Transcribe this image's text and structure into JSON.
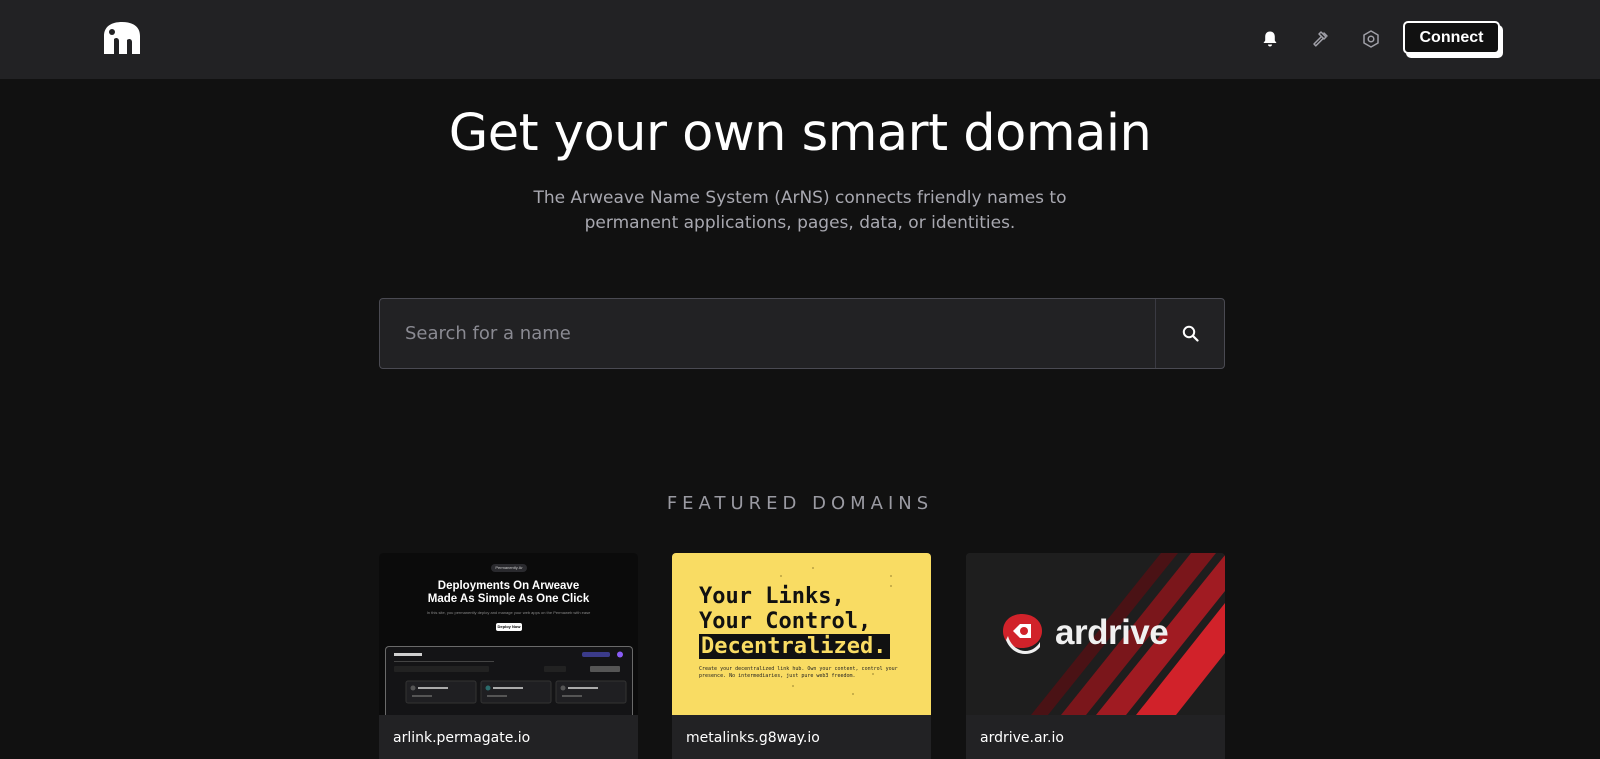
{
  "header": {
    "logo_icon": "elephant-logo-icon",
    "icons": [
      "bell-icon",
      "hammer-icon",
      "settings-hexagon-icon"
    ],
    "connect_label": "Connect"
  },
  "hero": {
    "title": "Get your own smart domain",
    "subtitle_line1": "The Arweave Name System (ArNS) connects friendly names to",
    "subtitle_line2": "permanent applications, pages, data, or identities."
  },
  "search": {
    "placeholder": "Search for a name",
    "button_icon": "search-icon"
  },
  "featured": {
    "heading": "FEATURED DOMAINS",
    "cards": [
      {
        "label": "arlink.permagate.io",
        "thumb": {
          "pill": "Permanently Ar",
          "title_line1": "Deployments On Arweave",
          "title_line2": "Made As Simple As One Click",
          "small": "In this site, you permanently deploy and manage your web apps on the Permaweb with ease",
          "cta": "Deploy Now"
        }
      },
      {
        "label": "metalinks.g8way.io",
        "thumb": {
          "line1": "Your Links,",
          "line2": "Your Control,",
          "line3": "Decentralized.",
          "small": "Create your decentralized link hub. Own your content, control your presence. No intermediaries, just pure web3 freedom."
        }
      },
      {
        "label": "ardrive.ar.io",
        "thumb": {
          "brand": "ardrive"
        }
      }
    ]
  },
  "colors": {
    "page_bg": "#111111",
    "header_bg": "#222224",
    "card_bg": "#222224",
    "metalinks_yellow": "#f9dc63",
    "ardrive_red": "#d1222a"
  }
}
